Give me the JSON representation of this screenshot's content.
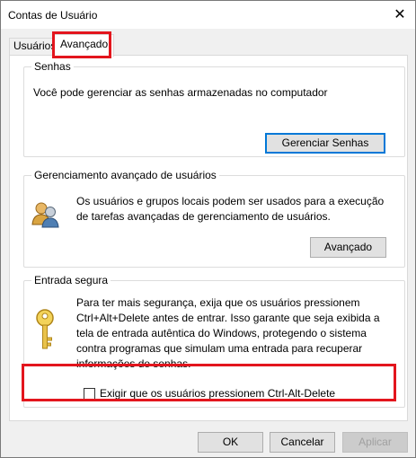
{
  "window": {
    "title": "Contas de Usuário",
    "close_label": "✕"
  },
  "tabs": [
    {
      "label": "Usuários",
      "selected": false
    },
    {
      "label": "Avançado",
      "selected": true
    }
  ],
  "sections": {
    "senhas": {
      "title": "Senhas",
      "description": "Você pode gerenciar as senhas armazenadas no computador",
      "button_label": "Gerenciar Senhas"
    },
    "gerenciamento": {
      "title": "Gerenciamento avançado de usuários",
      "description_line1": "Os usuários e grupos locais podem ser usados para a execução",
      "description_line2": "de tarefas avançadas de gerenciamento de usuários.",
      "icon": "users-icon",
      "button_label": "Avançado"
    },
    "entrada_segura": {
      "title": "Entrada segura",
      "description_lines": [
        "Para ter mais segurança, exija que os usuários pressionem",
        "Ctrl+Alt+Delete antes de entrar. Isso garante que seja exibida a",
        "tela de entrada autêntica do Windows, protegendo o sistema",
        "contra programas que simulam uma entrada para recuperar",
        "informações de senhas."
      ],
      "icon": "key-icon",
      "checkbox_label": "Exigir que os usuários pressionem Ctrl-Alt-Delete",
      "checkbox_checked": false
    }
  },
  "footer": {
    "ok_label": "OK",
    "cancel_label": "Cancelar",
    "apply_label": "Aplicar"
  },
  "colors": {
    "highlight": "#e3151d",
    "focus_border": "#0078d7"
  }
}
